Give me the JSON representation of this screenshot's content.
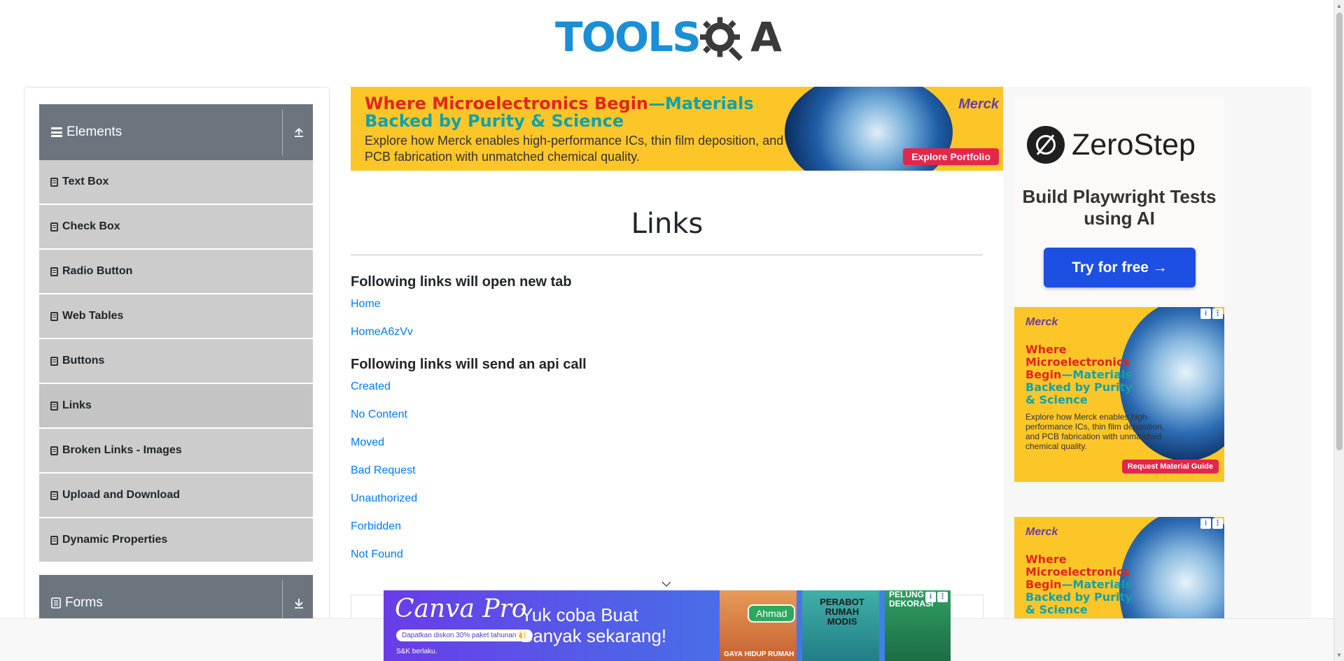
{
  "header": {
    "logo_text_tools": "TOOLS",
    "logo_text_qa": "A"
  },
  "sidebar": {
    "groups": [
      {
        "label": "Elements",
        "state": "expanded"
      },
      {
        "label": "Forms",
        "state": "collapsed"
      }
    ],
    "items": [
      {
        "label": "Text Box"
      },
      {
        "label": "Check Box"
      },
      {
        "label": "Radio Button"
      },
      {
        "label": "Web Tables"
      },
      {
        "label": "Buttons"
      },
      {
        "label": "Links",
        "active": true
      },
      {
        "label": "Broken Links - Images"
      },
      {
        "label": "Upload and Download"
      },
      {
        "label": "Dynamic Properties"
      }
    ]
  },
  "top_ad": {
    "headline_red": "Where Microelectronics Begin",
    "headline_teal": "—Materials Backed by Purity & Science",
    "body": "Explore how Merck enables high-performance ICs, thin film deposition, and PCB fabrication with unmatched chemical quality.",
    "brand": "Merck",
    "cta": "Explore Portfolio"
  },
  "main": {
    "title": "Links",
    "section1_title": "Following links will open new tab",
    "section1_links": [
      "Home",
      "HomeA6zVv"
    ],
    "section2_title": "Following links will send an api call",
    "section2_links": [
      "Created",
      "No Content",
      "Moved",
      "Bad Request",
      "Unauthorized",
      "Forbidden",
      "Not Found"
    ]
  },
  "right_ads": {
    "zerostep": {
      "name": "ZeroStep",
      "tagline": "Build Playwright Tests using AI",
      "cta": "Try for free →"
    },
    "merck1": {
      "brand": "Merck",
      "headline_red": "Where Microelectronics Begin",
      "headline_teal": "—Materials Backed by Purity & Science",
      "body": "Explore how Merck enables high-performance ICs, thin film deposition, and PCB fabrication with unmatched chemical quality.",
      "cta": "Request Material Guide"
    },
    "merck2": {
      "brand": "Merck",
      "headline_red": "Where Microelectronics Begin",
      "headline_teal": "—Materials Backed by Purity & Science"
    }
  },
  "bottom_ad": {
    "brand": "Canva Pro",
    "promo": "Dapatkan diskon 30% paket tahunan 👑",
    "fine_print": "S&K berlaku.",
    "text": "Yuk coba Buat Banyak sekarang!",
    "tile_pill": "Ahmad",
    "tile2_caption": "PERABOT RUMAH MODIS",
    "tile3_caption": "PELUNG DEKORASI",
    "tile1_footer": "GAYA HIDUP RUMAH"
  },
  "colors": {
    "brand_blue": "#1a8fd6",
    "sidebar_header": "#6c757d",
    "sidebar_item": "#cccccc",
    "link": "#007bff",
    "ad_yellow": "#fcc629"
  }
}
